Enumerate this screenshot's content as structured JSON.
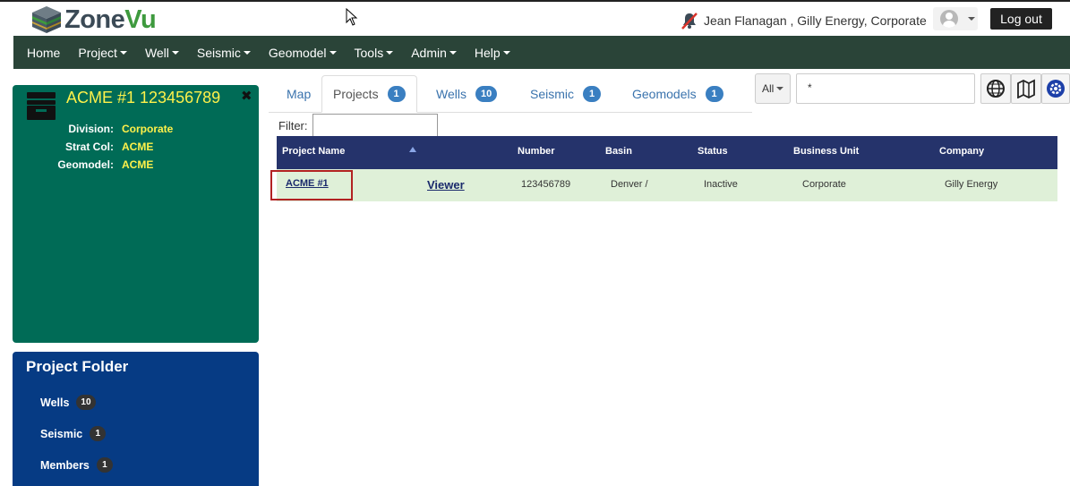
{
  "app": {
    "logo_zone": "Zone",
    "logo_vu": "Vu"
  },
  "header": {
    "user_text": "Jean Flanagan , Gilly Energy, Corporate",
    "logout_label": "Log out"
  },
  "nav": {
    "items": [
      {
        "label": "Home",
        "has_caret": false
      },
      {
        "label": "Project",
        "has_caret": true
      },
      {
        "label": "Well",
        "has_caret": true
      },
      {
        "label": "Seismic",
        "has_caret": true
      },
      {
        "label": "Geomodel",
        "has_caret": true
      },
      {
        "label": "Tools",
        "has_caret": true
      },
      {
        "label": "Admin",
        "has_caret": true
      },
      {
        "label": "Help",
        "has_caret": true
      }
    ]
  },
  "project_panel": {
    "title": "ACME #1 123456789",
    "rows": [
      {
        "label": "Division:",
        "value": "Corporate"
      },
      {
        "label": "Strat Col:",
        "value": "ACME"
      },
      {
        "label": "Geomodel:",
        "value": "ACME"
      }
    ]
  },
  "folder_panel": {
    "title": "Project Folder",
    "items": [
      {
        "label": "Wells",
        "count": "10"
      },
      {
        "label": "Seismic",
        "count": "1"
      },
      {
        "label": "Members",
        "count": "1"
      }
    ]
  },
  "tabs": [
    {
      "label": "Map",
      "count": null,
      "active": false
    },
    {
      "label": "Projects",
      "count": "1",
      "active": true
    },
    {
      "label": "Wells",
      "count": "10",
      "active": false
    },
    {
      "label": "Seismic",
      "count": "1",
      "active": false
    },
    {
      "label": "Geomodels",
      "count": "1",
      "active": false
    }
  ],
  "search": {
    "scope": "All",
    "value": "*"
  },
  "filter": {
    "label": "Filter:",
    "value": ""
  },
  "table": {
    "columns": [
      "Project Name",
      "Number",
      "Basin",
      "Status",
      "Business Unit",
      "Company"
    ],
    "rows": [
      {
        "project_name": "ACME #1",
        "viewer": "Viewer",
        "number": "123456789",
        "basin": "Denver /",
        "status": "Inactive",
        "business_unit": "Corporate",
        "company": "Gilly Energy"
      }
    ]
  },
  "colors": {
    "nav_bg": "#2a4438",
    "project_panel_bg": "#006b56",
    "project_title": "#fff14a",
    "folder_panel_bg": "#063b84",
    "table_head_bg": "#25336b",
    "selected_row_bg": "#dff0d8",
    "badge_blue": "#3a7fc1",
    "highlight_border": "#b22222"
  }
}
